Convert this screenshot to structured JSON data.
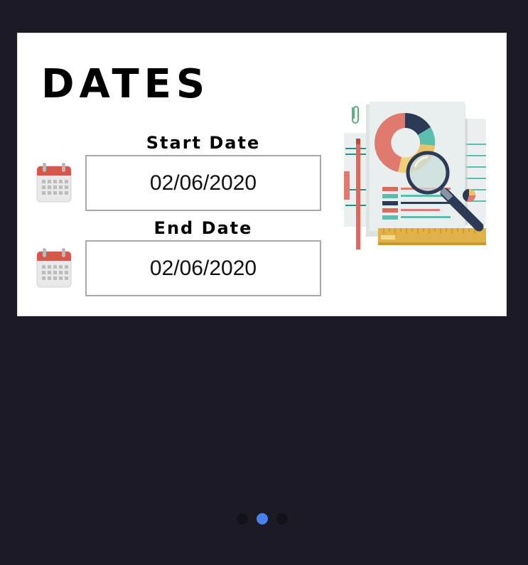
{
  "card": {
    "title": "DATES",
    "start": {
      "label": "Start Date",
      "value": "02/06/2020",
      "icon": "calendar-icon"
    },
    "end": {
      "label": "End Date",
      "value": "02/06/2020",
      "icon": "calendar-icon"
    },
    "illustration": "report-magnifier-illustration"
  },
  "pager": {
    "count": 3,
    "active_index": 1,
    "active_color": "#4a7ff0",
    "inactive_color": "#13121a"
  },
  "colors": {
    "background": "#1c1b25",
    "card": "#ffffff",
    "calendar_red": "#d9574a"
  }
}
